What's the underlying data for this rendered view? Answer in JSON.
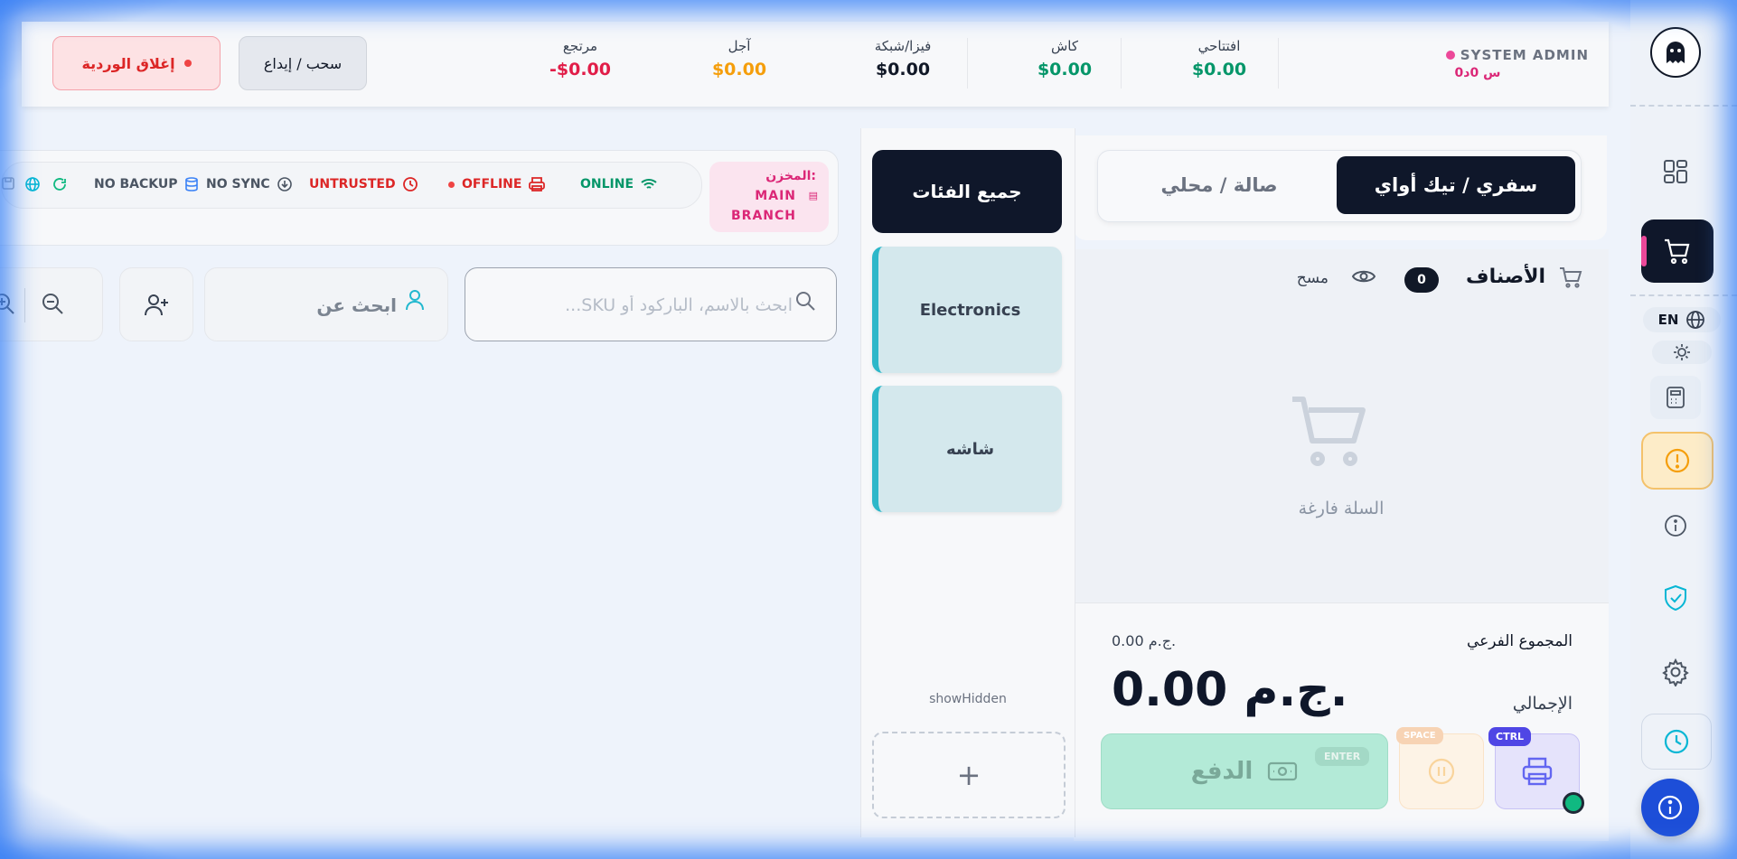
{
  "user": {
    "name": "SYSTEM ADMIN",
    "session_time": "0س 0د"
  },
  "stats": [
    {
      "label": "افتتاحي",
      "value": "$0.00",
      "color": "#059669"
    },
    {
      "label": "كاش",
      "value": "$0.00",
      "color": "#059669"
    },
    {
      "label": "فيزا/شبكة",
      "value": "$0.00",
      "color": "#111827"
    },
    {
      "label": "آجل",
      "value": "$0.00",
      "color": "#f59e0b"
    },
    {
      "label": "مرتجع",
      "value": "-$0.00",
      "color": "#e11d48"
    }
  ],
  "shift": {
    "deposit_label": "سحب / إيداع",
    "close_label": "إغلاق الوردية"
  },
  "order_type": {
    "takeaway": "سفري / تيك أواي",
    "dine_in": "صالة / محلي"
  },
  "cart": {
    "title": "الأصناف",
    "count": "0",
    "clear_label": "مسح",
    "empty_text": "السلة فارغة",
    "subtotal_label": "المجموع الفرعي",
    "subtotal_value": "0.00 ج.م.",
    "total_label": "الإجمالي",
    "total_value": "0.00 ج.م.",
    "pay_label": "الدفع",
    "pay_key": "ENTER",
    "hold_key": "SPACE",
    "print_key": "CTRL"
  },
  "categories": {
    "all_label": "جميع الفئات",
    "items": [
      "Electronics",
      "شاشه"
    ],
    "show_hidden": "showHidden",
    "add_symbol": "+"
  },
  "status": {
    "branch_label": "المخزن:",
    "branch_line1": "MAIN",
    "branch_line2": "BRANCH",
    "online": "ONLINE",
    "offline": "OFFLINE",
    "untrusted": "UNTRUSTED",
    "sync": "NO SYNC",
    "backup": "NO BACKUP"
  },
  "search": {
    "product_placeholder": "ابحث بالاسم، الباركود أو SKU...",
    "customer_placeholder": "ابحث عن"
  },
  "rail": {
    "language": "EN"
  }
}
